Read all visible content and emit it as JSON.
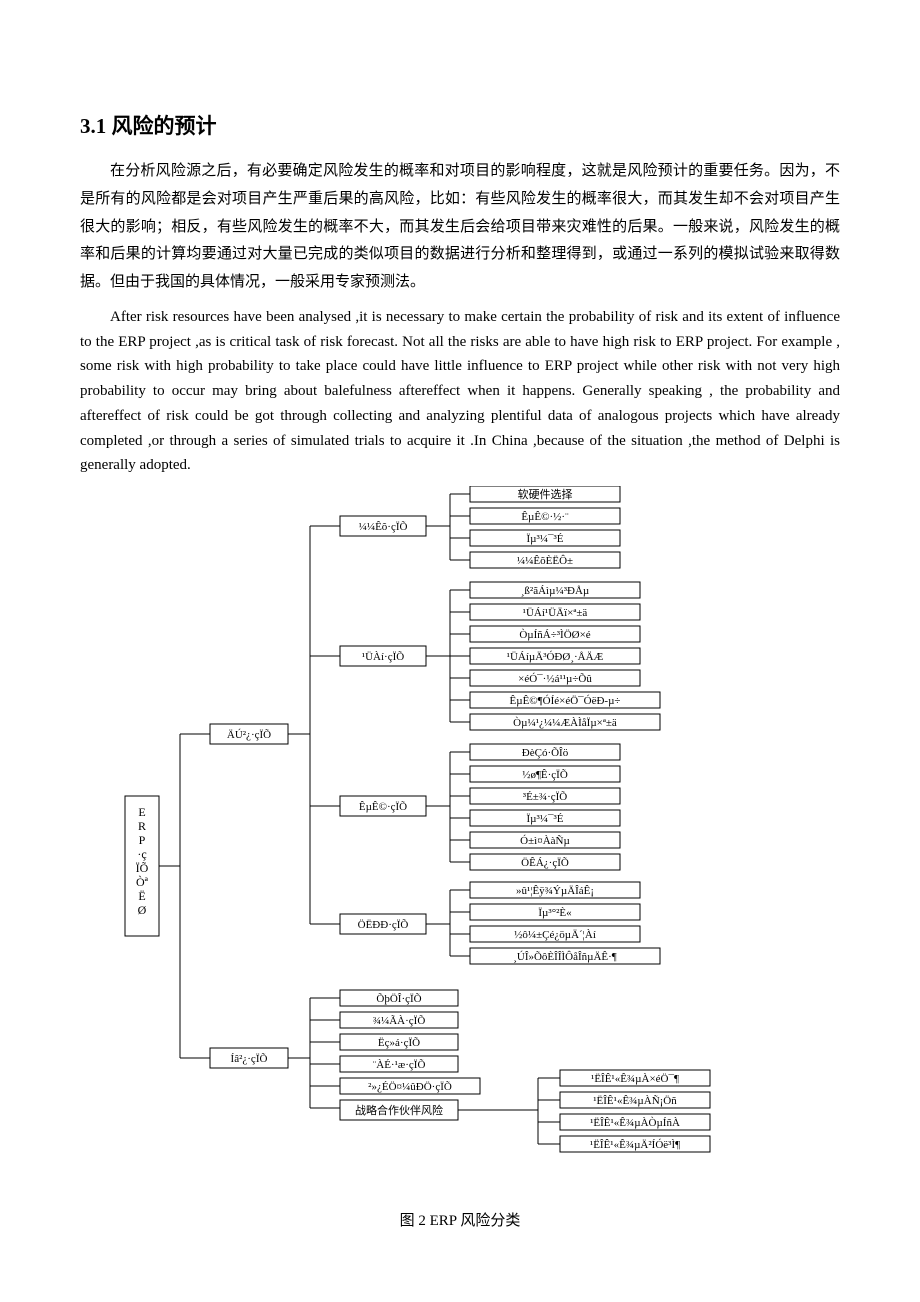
{
  "heading": "3.1  风险的预计",
  "para_cn": "在分析风险源之后，有必要确定风险发生的概率和对项目的影响程度，这就是风险预计的重要任务。因为，不是所有的风险都是会对项目产生严重后果的高风险，比如：有些风险发生的概率很大，而其发生却不会对项目产生很大的影响；相反，有些风险发生的概率不大，而其发生后会给项目带来灾难性的后果。一般来说，风险发生的概率和后果的计算均要通过对大量已完成的类似项目的数据进行分析和整理得到，或通过一系列的模拟试验来取得数据。但由于我国的具体情况，一般采用专家预测法。",
  "para_en": "After risk resources have been analysed ,it is necessary to make certain the probability of risk and its extent of influence to the ERP project ,as is critical task of risk forecast. Not all the risks are able to have high risk to ERP project. For example , some risk with high probability to take place could have little influence to ERP project while other risk with not very high probability to occur may bring about balefulness aftereffect when it happens. Generally speaking , the probability and aftereffect of risk could be got through collecting and analyzing plentiful data of analogous projects which have already completed ,or through a series of simulated trials to acquire it .In China ,because of the situation ,the method of Delphi is generally adopted.",
  "caption": "图 2      ERP 风险分类",
  "diagram": {
    "root": "ERP·çÏÕÒªËØ",
    "l1": [
      {
        "label": "ÄÚ²¿·çÏÕ"
      },
      {
        "label": "Íâ²¿·çÏÕ"
      }
    ],
    "inner_children": [
      {
        "label": "¼¼Êõ·çÏÕ",
        "leaves": [
          "软硬件选择",
          "ÊµÊ©·½·¨",
          "Ïµ³¼¯³É",
          "¼¼ÊõÈËÔ±"
        ]
      },
      {
        "label": "¹ÜÀí·çÏÕ",
        "leaves": [
          "¸ß²ãÁìµ¼³ÐÅµ",
          "¹ÜÁí¹ÜÄï×ª±ä",
          "ÒµÍñÁ÷³ÌÖØ×é",
          "¹ÜÁíµÄ³ÓÐØ¸·ÅÄÆ",
          "×éÓ¯·½á¹¹µ÷Õû",
          "ÊµÊ©¶ÓÍé×éÖ¯ÓëÐ-µ÷",
          "Òµ¼¹¿¼¼ÆÀÌåÏµ×ª±ä"
        ]
      },
      {
        "label": "ÊµÊ©·çÏÕ",
        "leaves": [
          "ÐèÇó·ÕÎö",
          "½ø¶Ê·çÏÕ",
          "³É±¾·çÏÕ",
          "Ïµ³¼¯³É",
          "Ó±ì¤ÀàÑµ",
          "ÖÊÁ¿·çÏÕ"
        ]
      },
      {
        "label": "ÖËÐÐ·çÏÕ",
        "leaves": [
          "»û¹¦Êÿ¾ÝµÄÎáÊ¡",
          "Ïµ³°²È«",
          "½ô¼±Çé¿öµÄ´¦Àí",
          "¸ÚÎ»ÕôÈÎÎÌÔåÎñµÄÊ·¶"
        ]
      }
    ],
    "outer_children_simple": [
      "ÕþÖÎ·çÏÕ",
      "¾­¼ÃÀ·çÏÕ",
      "Ëç»á·çÏÕ",
      "¨ÀÉ·¹æ·çÏÕ",
      "²»¿ÉÖ¤¼ûÐÖ·çÏÕ"
    ],
    "outer_partner": {
      "label": "战略合作伙伴风险",
      "leaves": [
        "¹ËÎÊ¹«Ê¾µÀ×éÖ¯¶",
        "¹ËÎÊ¹«Ê¾µÀÑ¡Öñ",
        "¹ËÎÊ¹«Ê¾µÀÒµÍñÀ",
        "¹ËÎÊ¹«Ê¾µÄ²ÍÓë³Ì¶"
      ]
    }
  }
}
